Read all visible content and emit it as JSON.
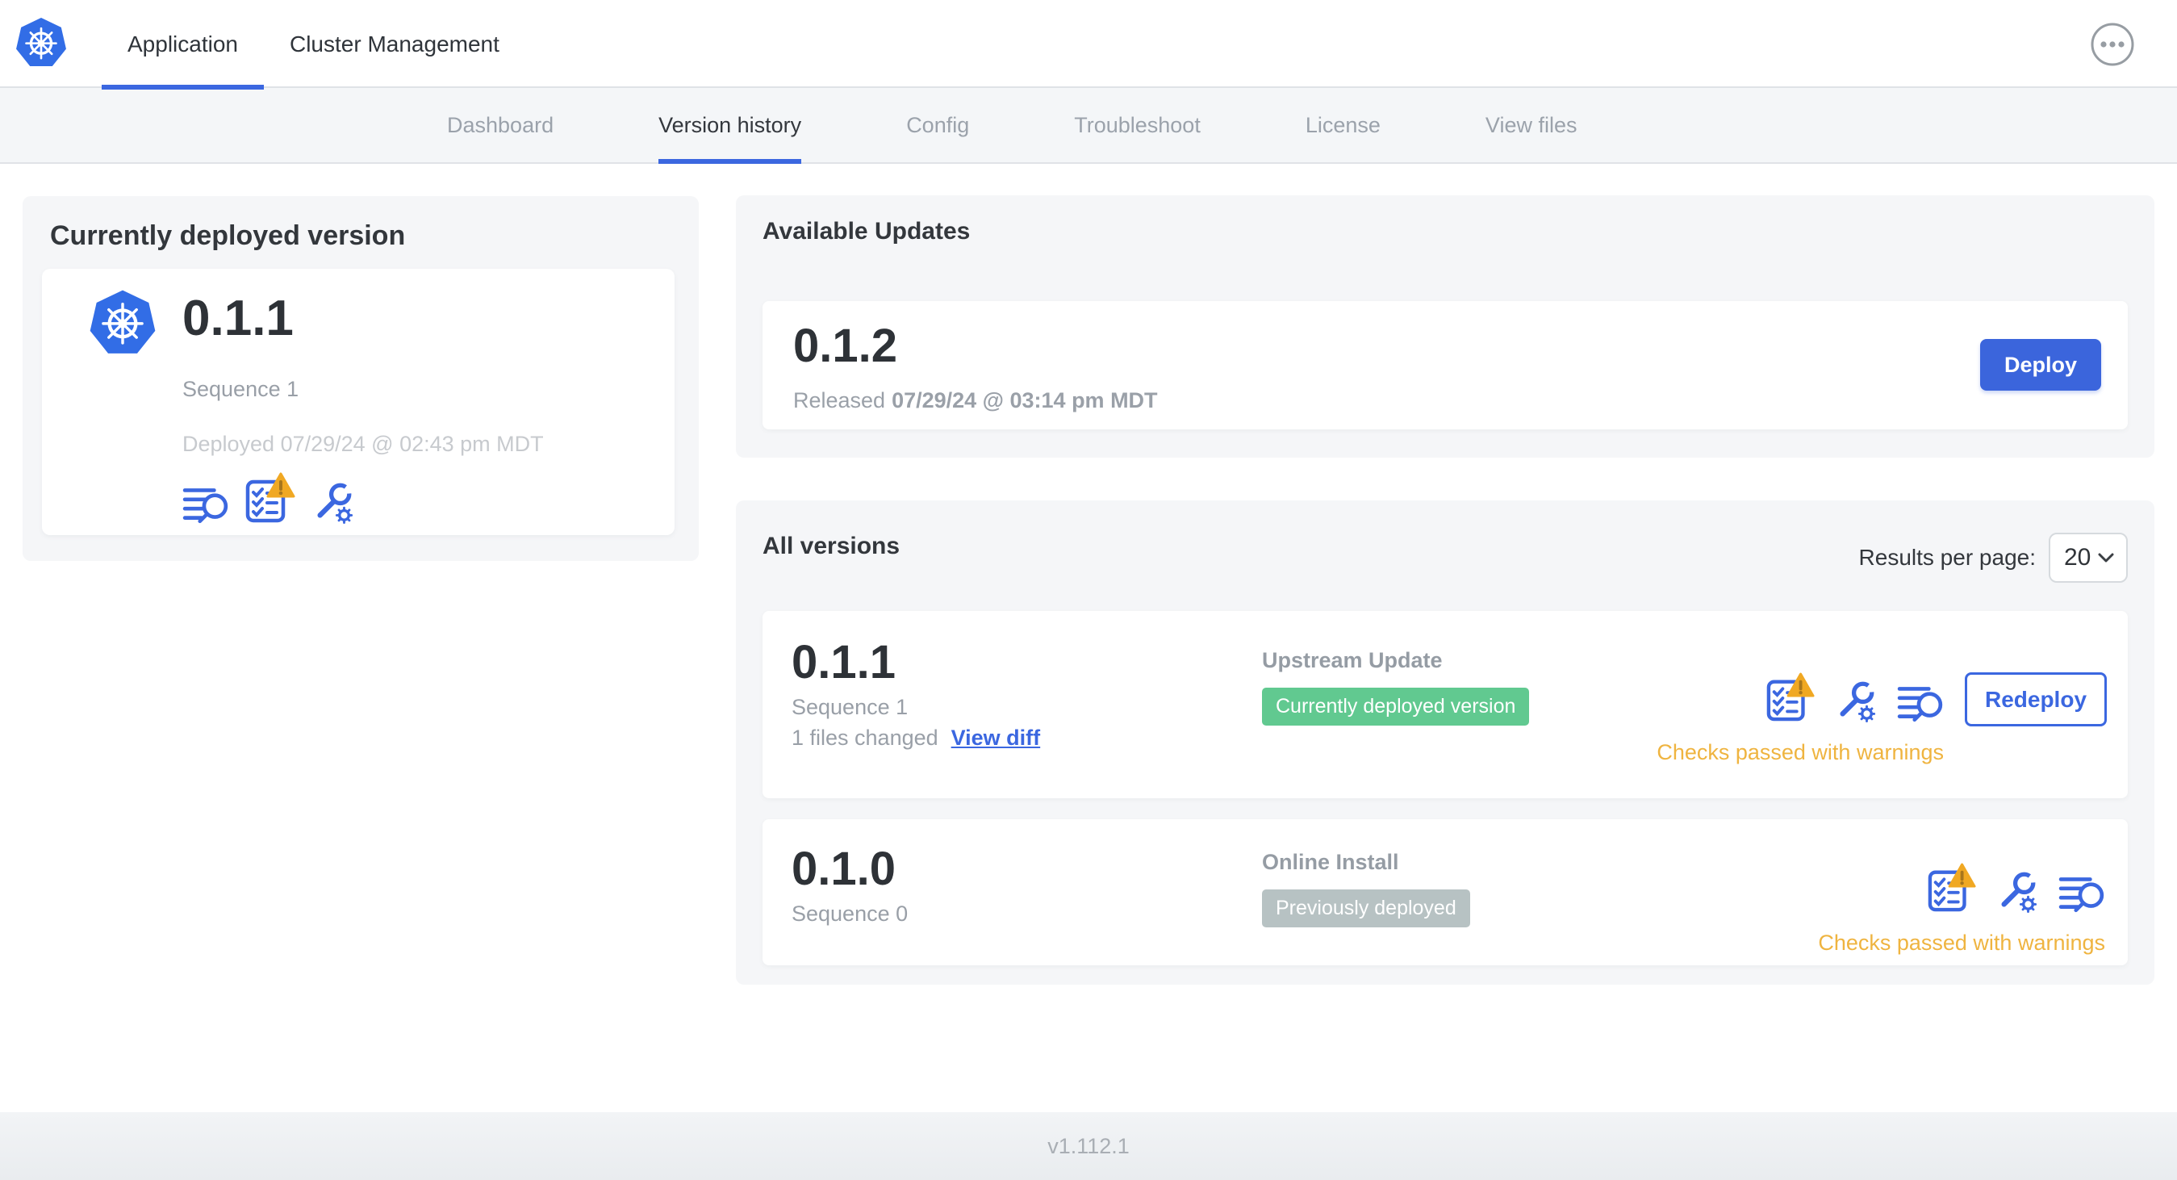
{
  "colors": {
    "primary_blue": "#3b67e0",
    "logo_blue": "#326de6",
    "badge_green": "#61c990",
    "badge_gray": "#b7c2c3",
    "warning_text": "#efb440",
    "warning_triangle": "#f0a823"
  },
  "header": {
    "tabs": [
      {
        "label": "Application"
      },
      {
        "label": "Cluster Management"
      }
    ]
  },
  "subnav": {
    "items": [
      {
        "label": "Dashboard"
      },
      {
        "label": "Version history"
      },
      {
        "label": "Config"
      },
      {
        "label": "Troubleshoot"
      },
      {
        "label": "License"
      },
      {
        "label": "View files"
      }
    ]
  },
  "currently_deployed": {
    "title": "Currently deployed version",
    "version": "0.1.1",
    "sequence": "Sequence 1",
    "deployed_timestamp": "Deployed 07/29/24 @ 02:43 pm MDT"
  },
  "available_updates": {
    "title": "Available Updates",
    "version": "0.1.2",
    "released_label": "Released",
    "released_timestamp": "07/29/24 @ 03:14 pm MDT",
    "deploy_button": "Deploy"
  },
  "all_versions": {
    "title": "All versions",
    "results_per_page_label": "Results per page:",
    "results_per_page_value": "20",
    "rows": [
      {
        "version": "0.1.1",
        "sequence": "Sequence 1",
        "files_changed": "1 files changed",
        "view_diff_link": "View diff",
        "source": "Upstream Update",
        "badge": "Currently deployed version",
        "redeploy_button": "Redeploy",
        "status": "Checks passed with warnings"
      },
      {
        "version": "0.1.0",
        "sequence": "Sequence 0",
        "source": "Online Install",
        "badge": "Previously deployed",
        "status": "Checks passed with warnings"
      }
    ]
  },
  "footer": {
    "app_version": "v1.112.1"
  }
}
